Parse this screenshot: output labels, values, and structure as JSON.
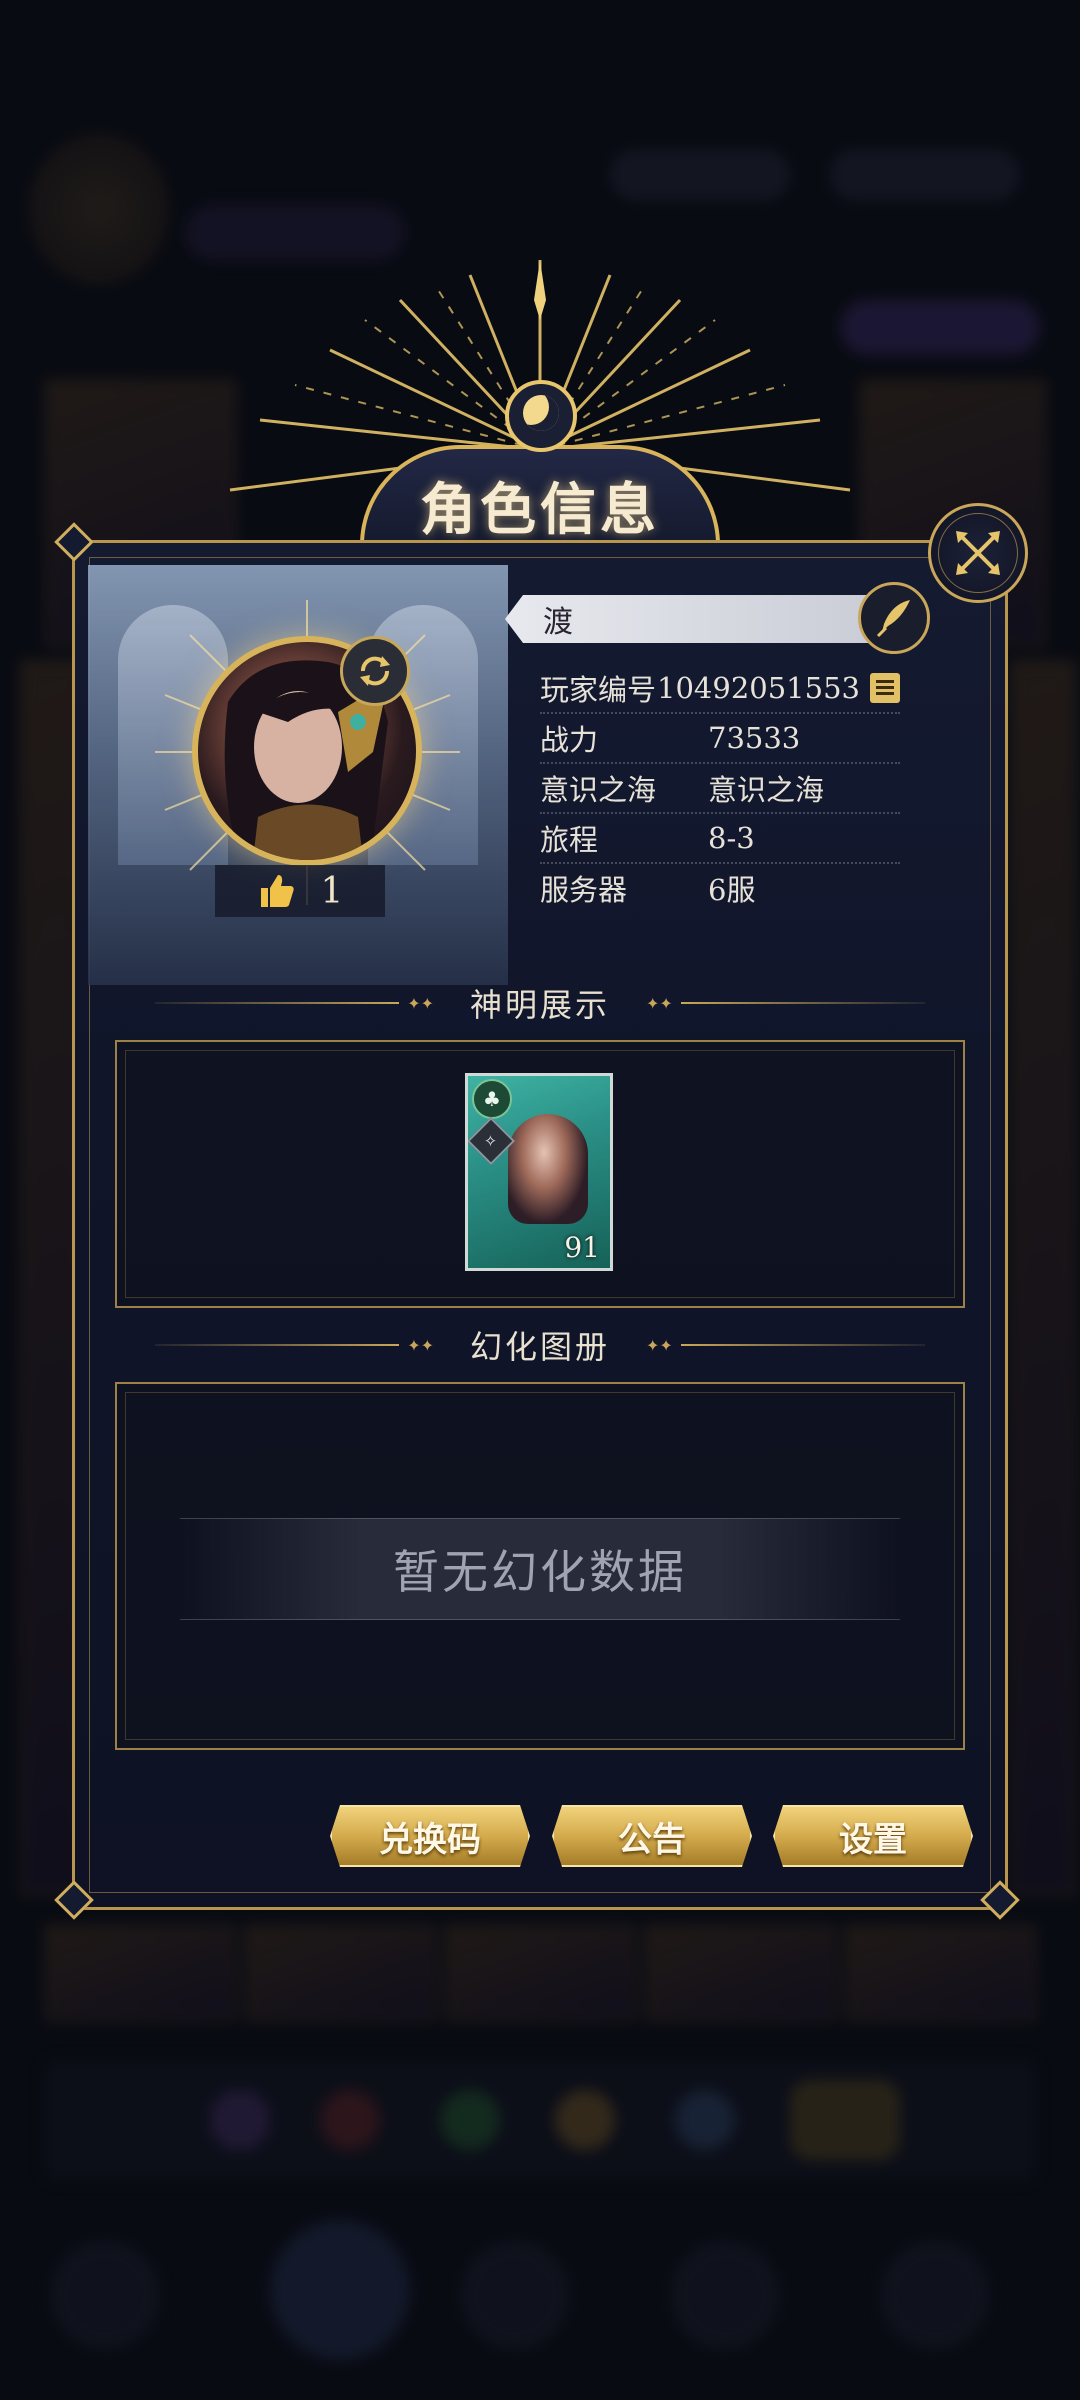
{
  "header": {
    "title": "角色信息"
  },
  "profile": {
    "name": "渡",
    "likes": "1",
    "info": [
      {
        "label": "玩家编号",
        "value": "10492051553",
        "copyable": true
      },
      {
        "label": "战力",
        "value": "73533"
      },
      {
        "label": "意识之海",
        "value": "意识之海"
      },
      {
        "label": "旅程",
        "value": "8-3"
      },
      {
        "label": "服务器",
        "value": "6服"
      }
    ]
  },
  "god_showcase": {
    "title": "神明展示",
    "cards": [
      {
        "level": "91",
        "suit_icon": "club-icon",
        "class_icon": "compass-icon"
      }
    ]
  },
  "transform_album": {
    "title": "幻化图册",
    "empty_text": "暂无幻化数据"
  },
  "buttons": {
    "redeem": "兑换码",
    "notice": "公告",
    "settings": "设置"
  },
  "colors": {
    "gold": "#c9a65a",
    "panel": "#141a30",
    "button_gold": "#d4ab4c",
    "card_teal": "#2a8f86"
  }
}
